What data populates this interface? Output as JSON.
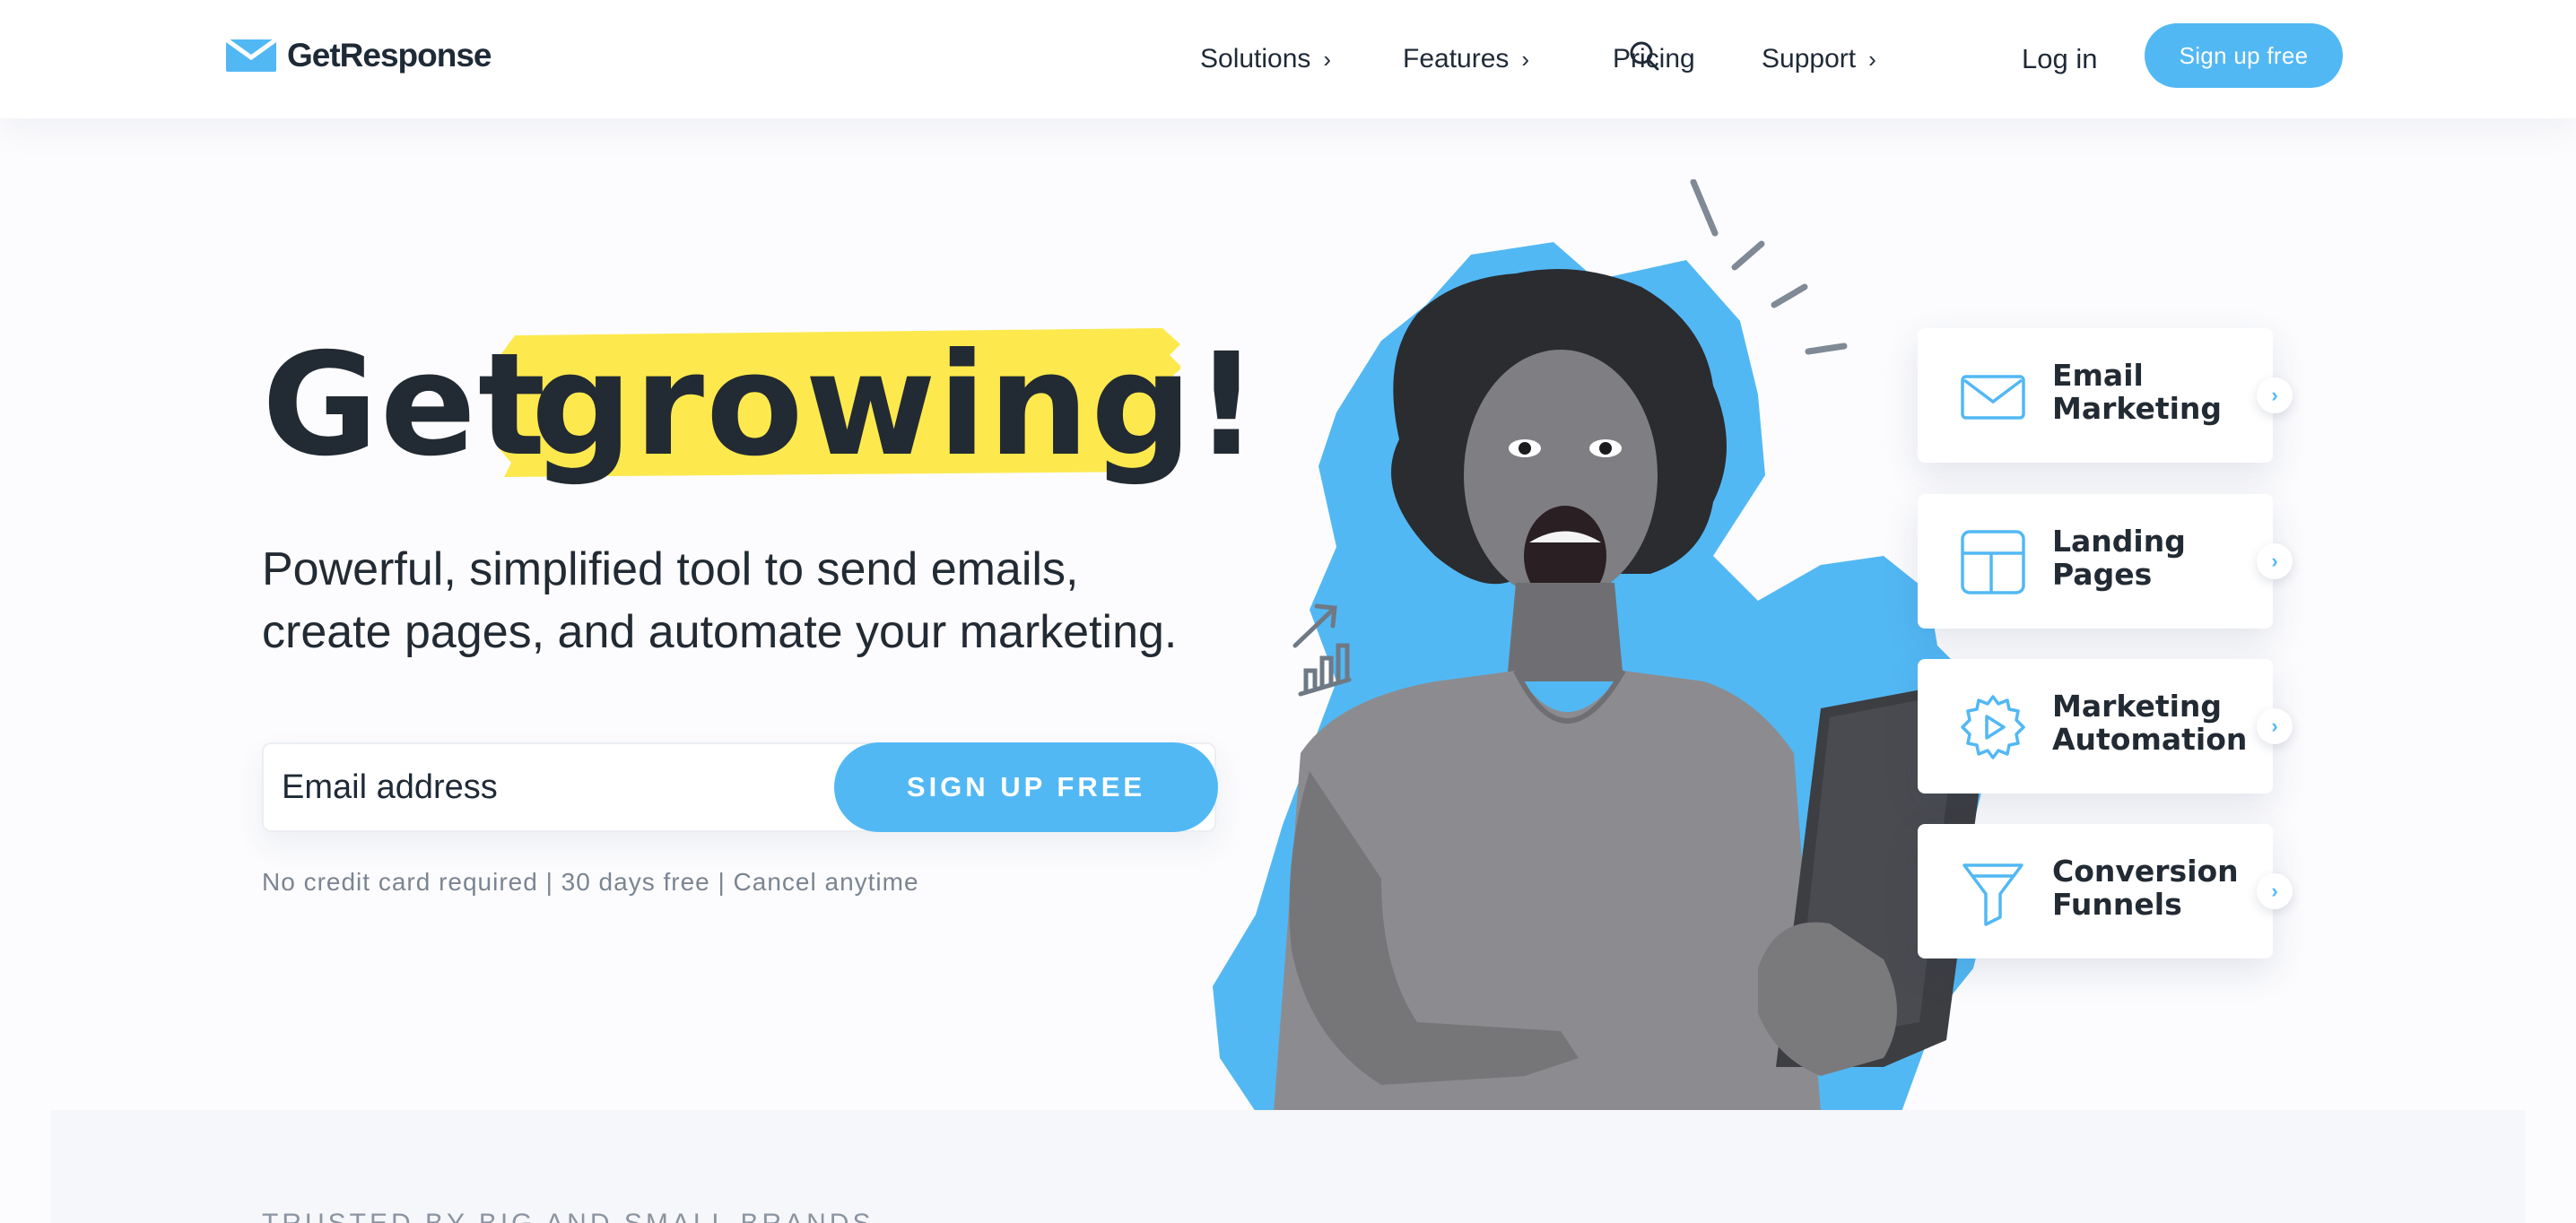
{
  "brand": {
    "name": "GetResponse",
    "accent_color": "#52b8f4",
    "highlight_color": "#fde94d",
    "text_color": "#222a33"
  },
  "header": {
    "nav": [
      {
        "label": "Solutions",
        "has_submenu": true
      },
      {
        "label": "Features",
        "has_submenu": true
      },
      {
        "label": "Pricing",
        "has_submenu": false
      },
      {
        "label": "Support",
        "has_submenu": true
      }
    ],
    "search_icon": "search-icon",
    "login_label": "Log in",
    "signup_label": "Sign up free"
  },
  "hero": {
    "title_plain": "Get",
    "title_highlight": "growing!",
    "subtitle_lines": [
      "Powerful, simplified tool to send emails,",
      "create pages, and automate your marketing."
    ],
    "email_placeholder": "Email address",
    "cta_label": "SIGN UP FREE",
    "disclaimer": "No credit card required | 30 days free | Cancel anytime"
  },
  "features": [
    {
      "icon": "envelope-icon",
      "line1": "Email",
      "line2": "Marketing"
    },
    {
      "icon": "layout-icon",
      "line1": "Landing",
      "line2": "Pages"
    },
    {
      "icon": "gear-play-icon",
      "line1": "Marketing",
      "line2": "Automation"
    },
    {
      "icon": "funnel-icon",
      "line1": "Conversion",
      "line2": "Funnels"
    }
  ],
  "trusted": {
    "label": "TRUSTED BY BIG AND SMALL BRANDS"
  }
}
